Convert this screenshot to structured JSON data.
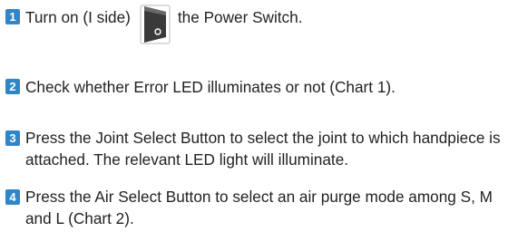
{
  "steps": [
    {
      "number": "1",
      "text_before_icon": "Turn on (I side)",
      "icon": "power-switch-icon",
      "text_after_icon": "the Power Switch."
    },
    {
      "number": "2",
      "text": "Check whether Error LED illuminates or not (Chart 1)."
    },
    {
      "number": "3",
      "text": "Press the Joint Select Button to select the joint to which handpiece is attached. The relevant LED light will illuminate."
    },
    {
      "number": "4",
      "text": "Press the Air Select Button to select an air purge mode among S, M and L (Chart 2)."
    }
  ],
  "colors": {
    "step_badge": "#2e86c9",
    "text": "#231f20"
  }
}
